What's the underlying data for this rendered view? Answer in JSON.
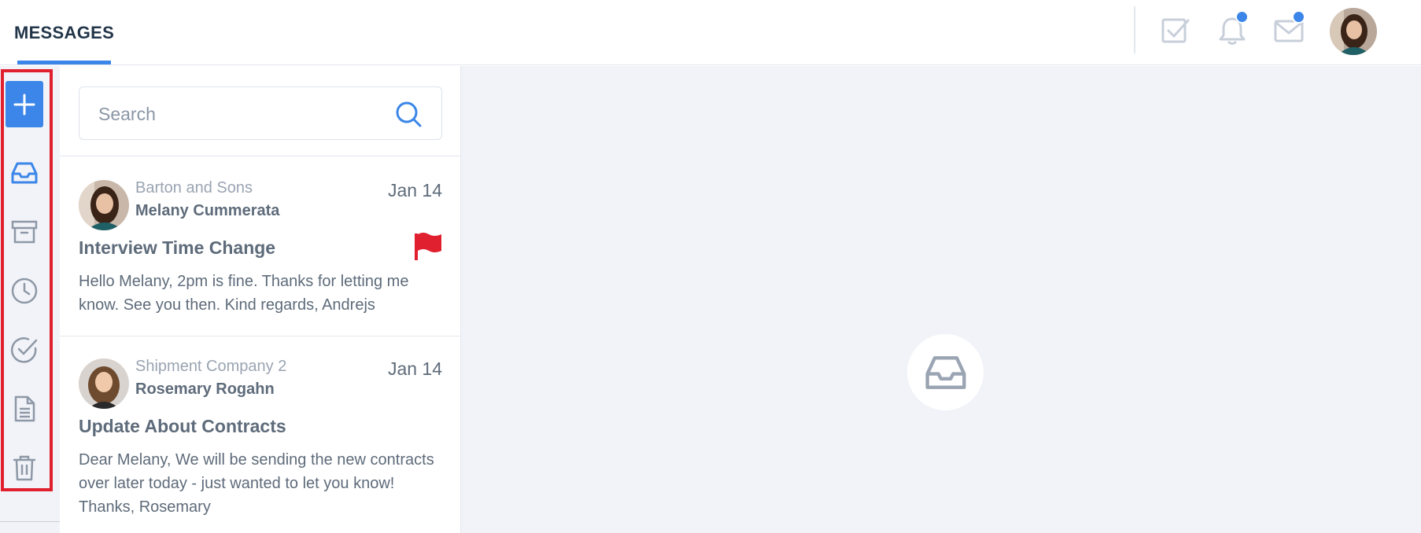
{
  "header": {
    "tab_label": "MESSAGES",
    "icons": [
      "checkbox-icon",
      "bell-icon",
      "mail-icon"
    ],
    "notification_badges": {
      "bell": true,
      "mail": true
    }
  },
  "sidebar": {
    "items": [
      {
        "name": "compose",
        "icon": "plus-icon"
      },
      {
        "name": "inbox",
        "icon": "inbox-icon",
        "active": true
      },
      {
        "name": "archive",
        "icon": "archive-icon"
      },
      {
        "name": "snoozed",
        "icon": "clock-icon"
      },
      {
        "name": "done",
        "icon": "check-circle-icon"
      },
      {
        "name": "drafts",
        "icon": "document-icon"
      },
      {
        "name": "trash",
        "icon": "trash-icon"
      }
    ]
  },
  "search": {
    "placeholder": "Search",
    "value": ""
  },
  "messages": [
    {
      "company": "Barton and Sons",
      "sender": "Melany Cummerata",
      "date": "Jan 14",
      "subject": "Interview Time Change",
      "preview": "Hello Melany, 2pm is fine. Thanks for letting me know. See you then. Kind regards, Andrejs",
      "flagged": true
    },
    {
      "company": "Shipment Company 2",
      "sender": "Rosemary Rogahn",
      "date": "Jan 14",
      "subject": "Update About Contracts",
      "preview": "Dear Melany, We will be sending the new contracts over later today - just wanted to let you know! Thanks, Rosemary",
      "flagged": false
    }
  ],
  "colors": {
    "accent": "#3b86e8",
    "flag": "#e0202e",
    "highlight_border": "#e0202e",
    "panel_bg": "#f1f3f8"
  }
}
